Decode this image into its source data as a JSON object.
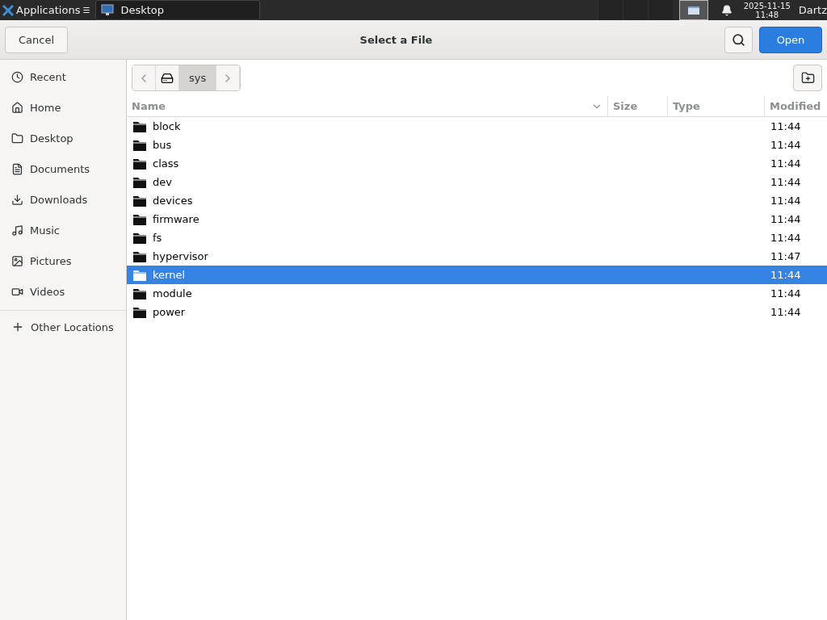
{
  "taskbar": {
    "menu": "Applications",
    "menu_mark": "☰",
    "window_button": {
      "label": "Desktop",
      "selected": true
    },
    "clock": {
      "date": "2025-11-15",
      "time": "11:48"
    },
    "user": "Dartz"
  },
  "dialog": {
    "title": "Select a File",
    "cancel": "Cancel",
    "open": "Open"
  },
  "sidebar": {
    "items": [
      {
        "label": "Recent",
        "kind": "recent",
        "selected": false
      },
      {
        "label": "Home",
        "kind": "home",
        "selected": false
      },
      {
        "label": "Desktop",
        "kind": "folder",
        "selected": false
      },
      {
        "label": "Documents",
        "kind": "document",
        "selected": false
      },
      {
        "label": "Downloads",
        "kind": "download",
        "selected": false
      },
      {
        "label": "Music",
        "kind": "music",
        "selected": false
      },
      {
        "label": "Pictures",
        "kind": "picture",
        "selected": false
      },
      {
        "label": "Videos",
        "kind": "video",
        "selected": false
      }
    ],
    "other": {
      "label": "Other Locations",
      "selected": false
    }
  },
  "path_bar": {
    "segments": [
      {
        "kind": "drive",
        "selected": false
      },
      {
        "label": "sys",
        "kind": "folder",
        "selected": true
      }
    ]
  },
  "table": {
    "columns": [
      "Name",
      "Size",
      "Type",
      "Modified"
    ],
    "rows": [
      {
        "name": "block",
        "modified": "11:44",
        "selected": false
      },
      {
        "name": "bus",
        "modified": "11:44",
        "selected": false
      },
      {
        "name": "class",
        "modified": "11:44",
        "selected": false
      },
      {
        "name": "dev",
        "modified": "11:44",
        "selected": false
      },
      {
        "name": "devices",
        "modified": "11:44",
        "selected": false
      },
      {
        "name": "firmware",
        "modified": "11:44",
        "selected": false
      },
      {
        "name": "fs",
        "modified": "11:44",
        "selected": false
      },
      {
        "name": "hypervisor",
        "modified": "11:47",
        "selected": false
      },
      {
        "name": "kernel",
        "modified": "11:44",
        "selected": true
      },
      {
        "name": "module",
        "modified": "11:44",
        "selected": false
      },
      {
        "name": "power",
        "modified": "11:44",
        "selected": false
      }
    ]
  }
}
